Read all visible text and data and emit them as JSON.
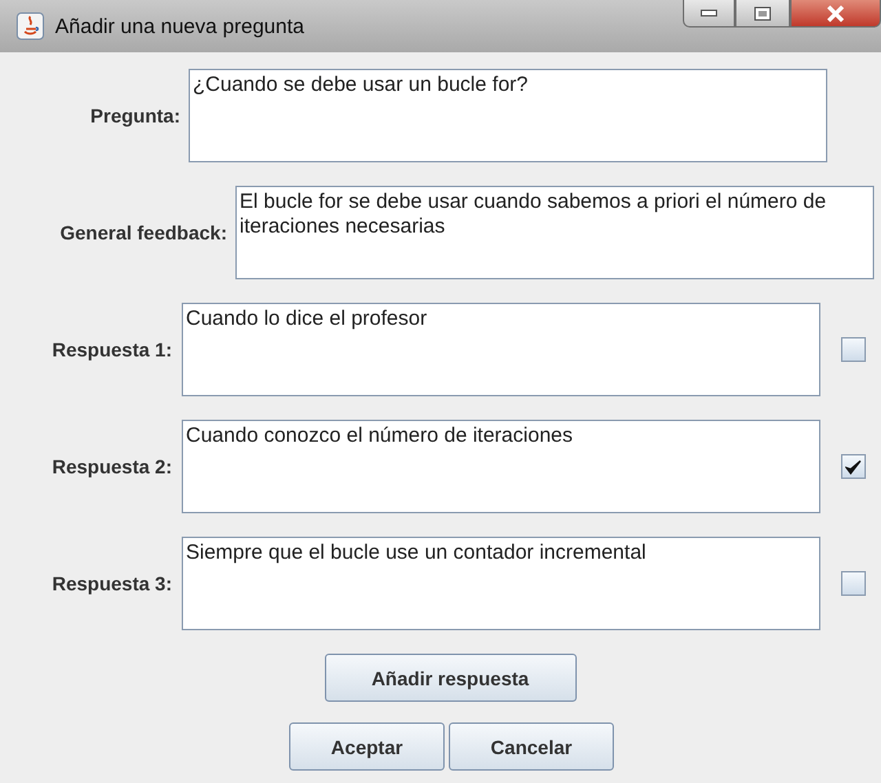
{
  "window": {
    "title": "Añadir una nueva pregunta"
  },
  "question": {
    "label": "Pregunta:",
    "value": "¿Cuando se debe usar un bucle for?"
  },
  "feedback": {
    "label": "General feedback:",
    "value": "El bucle for se debe usar cuando sabemos a priori el número de iteraciones necesarias"
  },
  "answers": [
    {
      "label": "Respuesta 1:",
      "value": "Cuando lo dice el profesor",
      "checked": false
    },
    {
      "label": "Respuesta 2:",
      "value": "Cuando conozco el número de iteraciones",
      "checked": true
    },
    {
      "label": "Respuesta 3:",
      "value": "Siempre que el bucle use un contador incremental",
      "checked": false
    }
  ],
  "add_button": "Añadir respuesta",
  "buttons": [
    "Aceptar",
    "Cancelar"
  ]
}
